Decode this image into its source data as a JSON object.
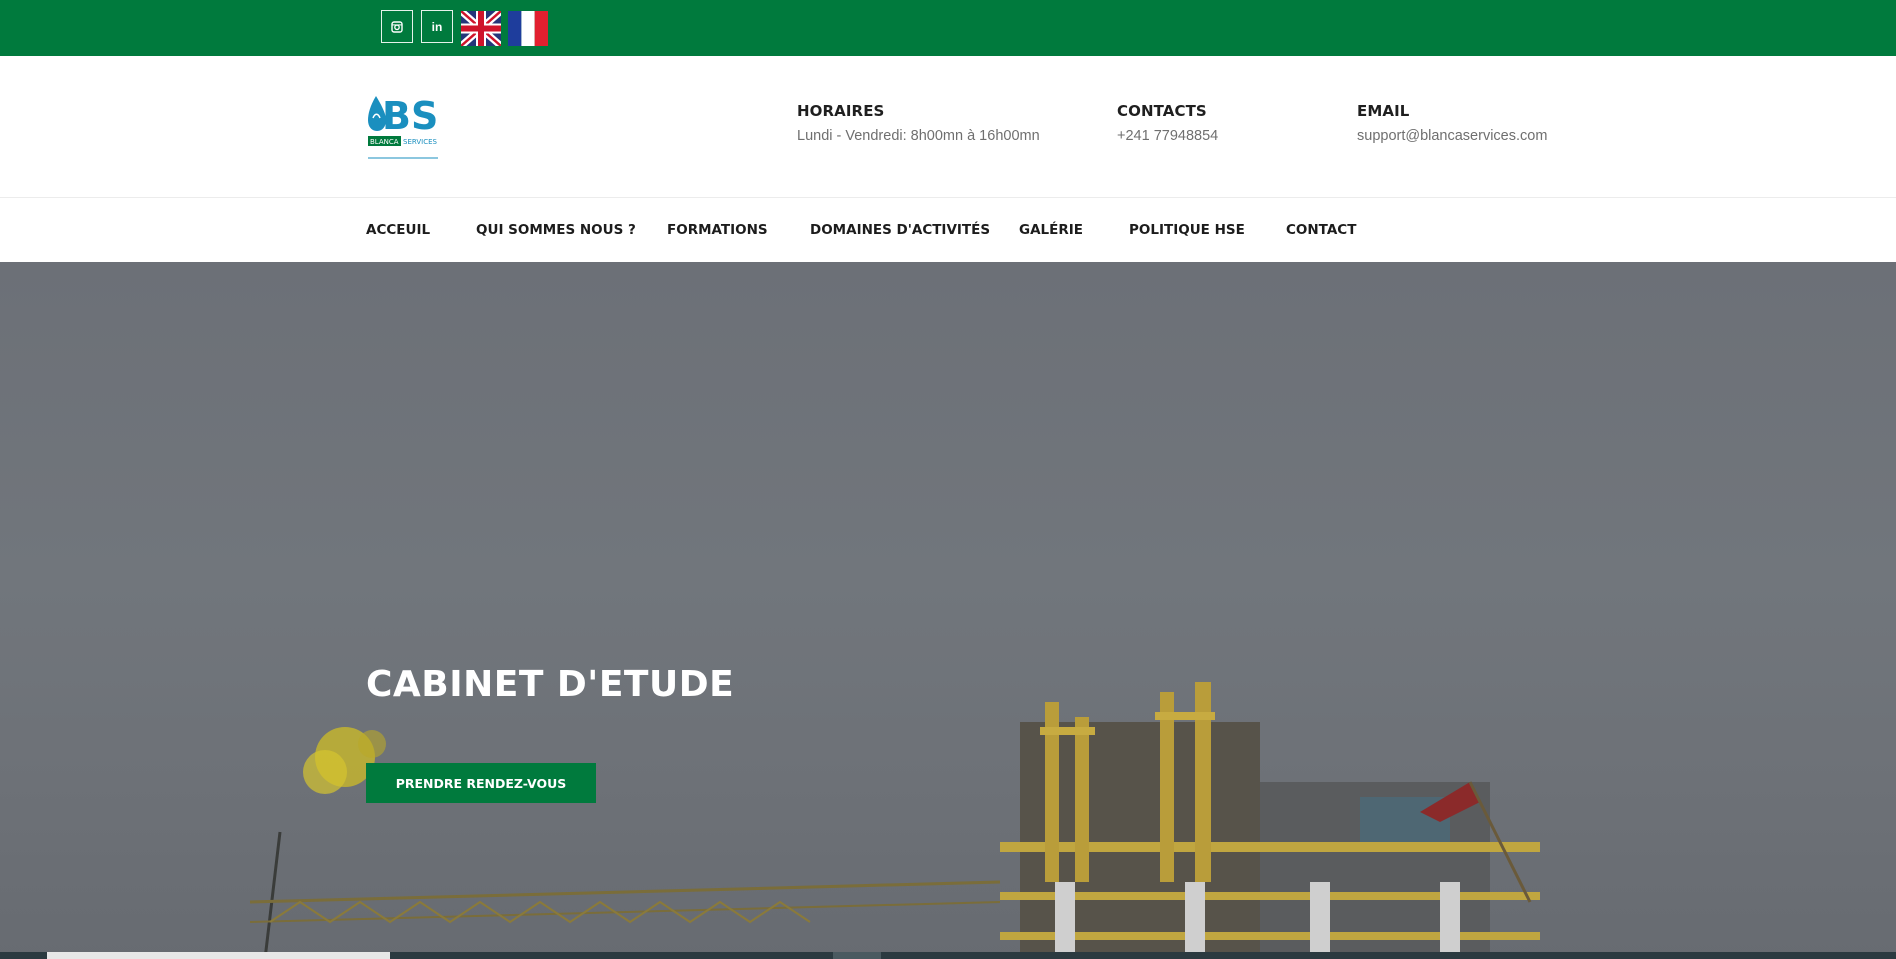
{
  "colors": {
    "brand_green": "#007a3d",
    "hero_overlay": "#6c7077"
  },
  "topbar": {
    "social": [
      {
        "name": "instagram",
        "icon": "instagram-icon",
        "glyph": "◙"
      },
      {
        "name": "linkedin",
        "icon": "linkedin-icon",
        "glyph": "in"
      }
    ],
    "flags": [
      {
        "name": "english",
        "icon": "uk-flag-icon"
      },
      {
        "name": "french",
        "icon": "france-flag-icon"
      }
    ]
  },
  "header": {
    "logo": {
      "text": "BS",
      "subtitle": "BLANCA SERVICES"
    },
    "hours": {
      "label": "HORAIRES",
      "value": "Lundi - Vendredi: 8h00mn à 16h00mn"
    },
    "contacts": {
      "label": "CONTACTS",
      "value": "+241 77948854"
    },
    "email": {
      "label": "EMAIL",
      "value": "support@blancaservices.com"
    }
  },
  "nav": {
    "items": [
      {
        "label": "ACCEUIL"
      },
      {
        "label": "QUI SOMMES NOUS ?"
      },
      {
        "label": "FORMATIONS"
      },
      {
        "label": "DOMAINES D'ACTIVITÉS"
      },
      {
        "label": "GALÉRIE"
      },
      {
        "label": "POLITIQUE HSE"
      },
      {
        "label": "CONTACT"
      }
    ]
  },
  "hero": {
    "title": "CABINET D'ETUDE",
    "cta": "PRENDRE RENDEZ-VOUS"
  }
}
